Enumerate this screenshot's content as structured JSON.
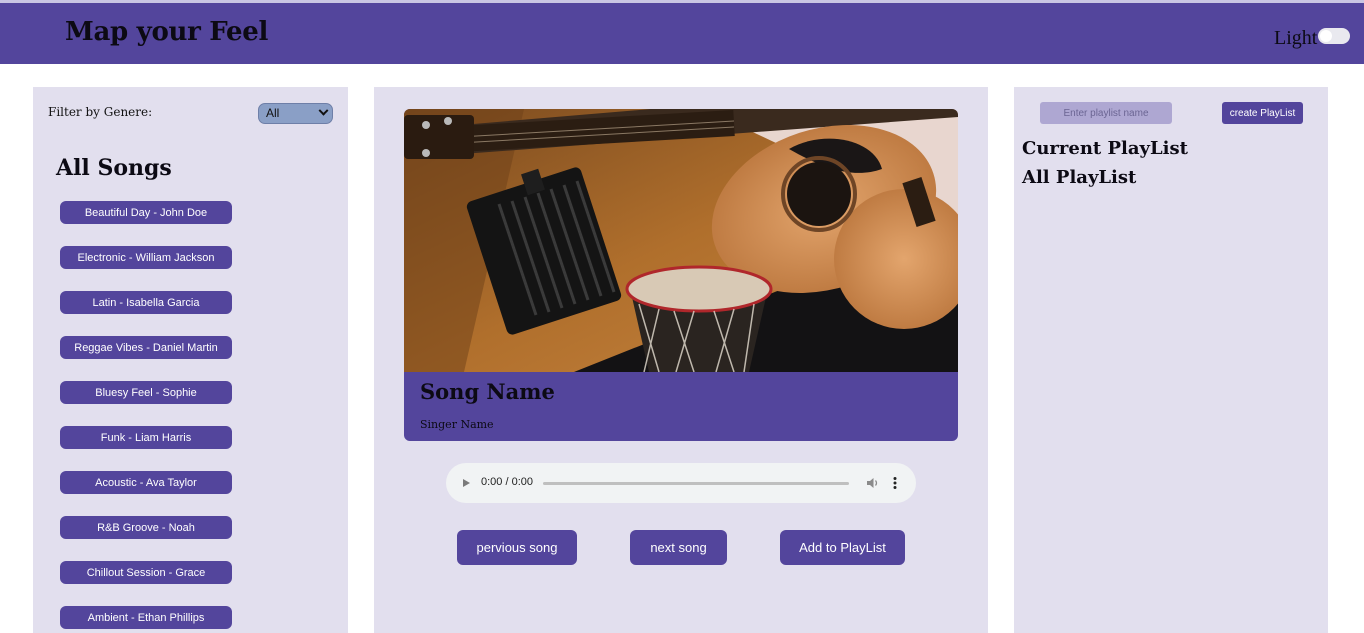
{
  "header": {
    "title": "Map your Feel",
    "theme_label": "Light",
    "theme_on": false
  },
  "filter": {
    "label": "Filter by Genere:",
    "selected": "All"
  },
  "songs": {
    "title": "All Songs",
    "items": [
      {
        "label": "Beautiful Day - John Doe"
      },
      {
        "label": "Electronic - William Jackson"
      },
      {
        "label": "Latin - Isabella Garcia"
      },
      {
        "label": "Reggae Vibes - Daniel Martin"
      },
      {
        "label": "Bluesy Feel - Sophie"
      },
      {
        "label": "Funk - Liam Harris"
      },
      {
        "label": "Acoustic - Ava Taylor"
      },
      {
        "label": "R&B Groove - Noah"
      },
      {
        "label": "Chillout Session - Grace"
      },
      {
        "label": "Ambient - Ethan Phillips"
      }
    ]
  },
  "now_playing": {
    "song_name": "Song Name",
    "singer_name": "Singer Name",
    "time": "0:00 / 0:00"
  },
  "controls": {
    "previous_label": "pervious song",
    "next_label": "next song",
    "add_label": "Add to PlayList"
  },
  "playlist": {
    "input_placeholder": "Enter playlist name",
    "create_label": "create PlayList",
    "current_title": "Current PlayList",
    "all_title": "All PlayList"
  },
  "colors": {
    "accent": "#53459c",
    "panel": "#e2dfee"
  }
}
